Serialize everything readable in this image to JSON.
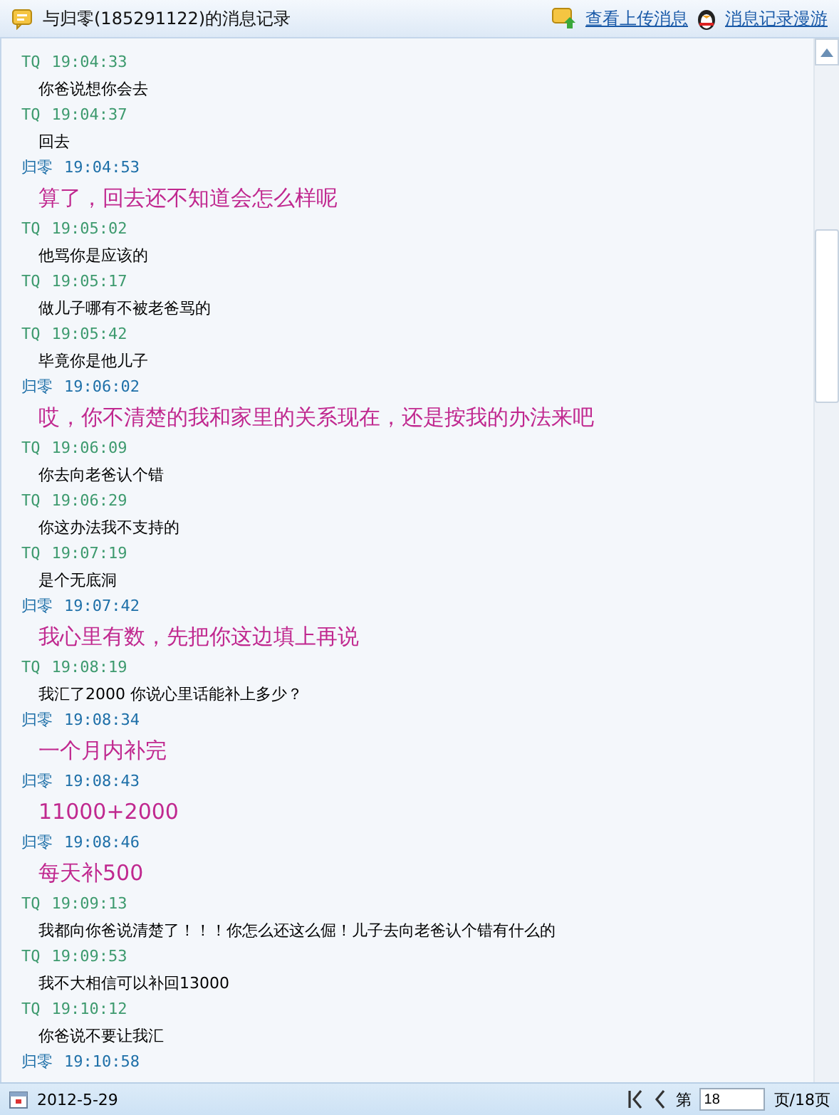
{
  "window": {
    "title": "与归零(185291122)的消息记录"
  },
  "toolbar": [
    {
      "label": "查看上传消息"
    },
    {
      "label": "消息记录漫游"
    }
  ],
  "messages": [
    {
      "kind": "self",
      "sender": "TQ",
      "time": "19:04:33",
      "text": "你爸说想你会去"
    },
    {
      "kind": "self",
      "sender": "TQ",
      "time": "19:04:37",
      "text": "回去"
    },
    {
      "kind": "other",
      "sender": "归零",
      "time": "19:04:53",
      "text": "算了，回去还不知道会怎么样呢"
    },
    {
      "kind": "self",
      "sender": "TQ",
      "time": "19:05:02",
      "text": "他骂你是应该的"
    },
    {
      "kind": "self",
      "sender": "TQ",
      "time": "19:05:17",
      "text": "做儿子哪有不被老爸骂的"
    },
    {
      "kind": "self",
      "sender": "TQ",
      "time": "19:05:42",
      "text": "毕竟你是他儿子"
    },
    {
      "kind": "other",
      "sender": "归零",
      "time": "19:06:02",
      "text": "哎，你不清楚的我和家里的关系现在，还是按我的办法来吧"
    },
    {
      "kind": "self",
      "sender": "TQ",
      "time": "19:06:09",
      "text": "你去向老爸认个错"
    },
    {
      "kind": "self",
      "sender": "TQ",
      "time": "19:06:29",
      "text": "你这办法我不支持的"
    },
    {
      "kind": "self",
      "sender": "TQ",
      "time": "19:07:19",
      "text": "是个无底洞"
    },
    {
      "kind": "other",
      "sender": "归零",
      "time": "19:07:42",
      "text": "我心里有数，先把你这边填上再说"
    },
    {
      "kind": "self",
      "sender": "TQ",
      "time": "19:08:19",
      "text": "我汇了2000 你说心里话能补上多少？"
    },
    {
      "kind": "other",
      "sender": "归零",
      "time": "19:08:34",
      "text": "一个月内补完"
    },
    {
      "kind": "other",
      "sender": "归零",
      "time": "19:08:43",
      "text": "11000+2000"
    },
    {
      "kind": "other",
      "sender": "归零",
      "time": "19:08:46",
      "text": "每天补500"
    },
    {
      "kind": "self",
      "sender": "TQ",
      "time": "19:09:13",
      "text": "我都向你爸说清楚了！！！你怎么还这么倔！儿子去向老爸认个错有什么的"
    },
    {
      "kind": "self",
      "sender": "TQ",
      "time": "19:09:53",
      "text": "我不大相信可以补回13000"
    },
    {
      "kind": "self",
      "sender": "TQ",
      "time": "19:10:12",
      "text": "你爸说不要让我汇"
    },
    {
      "kind": "other",
      "sender": "归零",
      "time": "19:10:58"
    }
  ],
  "status_bar": {
    "date": "2012-5-29",
    "page_prefix": "第",
    "page_value": "18",
    "page_suffix": "页/18页"
  }
}
